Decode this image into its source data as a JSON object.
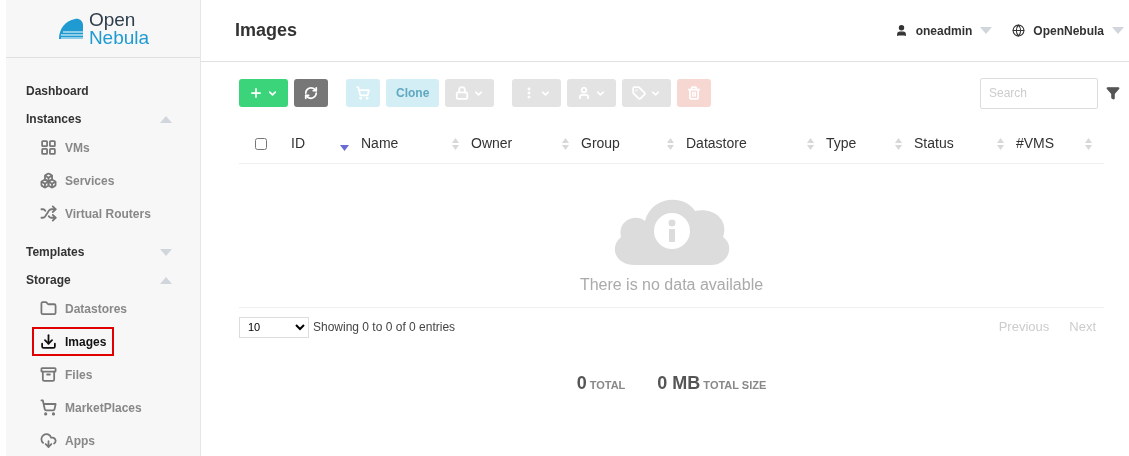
{
  "logo": {
    "line1": "Open",
    "line2": "Nebula"
  },
  "sidebar": [
    {
      "label": "Dashboard",
      "kind": "link"
    },
    {
      "label": "Instances",
      "kind": "section",
      "expanded": true,
      "children": [
        {
          "label": "VMs",
          "kind": "vms",
          "selected": false
        },
        {
          "label": "Services",
          "kind": "services",
          "selected": false
        },
        {
          "label": "Virtual Routers",
          "kind": "routers",
          "selected": false
        }
      ]
    },
    {
      "label": "Templates",
      "kind": "section",
      "expanded": false
    },
    {
      "label": "Storage",
      "kind": "section",
      "expanded": true,
      "children": [
        {
          "label": "Datastores",
          "kind": "datastores",
          "selected": false
        },
        {
          "label": "Images",
          "kind": "images",
          "selected": true
        },
        {
          "label": "Files",
          "kind": "files",
          "selected": false
        },
        {
          "label": "MarketPlaces",
          "kind": "marketplaces",
          "selected": false
        },
        {
          "label": "Apps",
          "kind": "apps",
          "selected": false
        }
      ]
    }
  ],
  "header": {
    "title": "Images",
    "user": "oneadmin",
    "zone": "OpenNebula"
  },
  "toolbar": [
    {
      "kind": "create",
      "disabled": false
    },
    {
      "kind": "refresh",
      "disabled": false
    },
    {
      "kind": "cart",
      "disabled": true
    },
    {
      "kind": "text",
      "label": "Clone",
      "disabled": true
    },
    {
      "kind": "lock",
      "disabled": true
    },
    {
      "kind": "more",
      "disabled": true
    },
    {
      "kind": "user",
      "disabled": true
    },
    {
      "kind": "tag",
      "disabled": true
    },
    {
      "kind": "delete",
      "disabled": true
    }
  ],
  "search": {
    "placeholder": "Search"
  },
  "table": {
    "select_all": {
      "checked": false
    },
    "columns": [
      {
        "label": "ID",
        "sorted": true
      },
      {
        "label": "Name",
        "sorted": false
      },
      {
        "label": "Owner",
        "sorted": false
      },
      {
        "label": "Group",
        "sorted": false
      },
      {
        "label": "Datastore",
        "sorted": false
      },
      {
        "label": "Type",
        "sorted": false
      },
      {
        "label": "Status",
        "sorted": false
      },
      {
        "label": "#VMS",
        "sorted": false
      }
    ],
    "empty_message": "There is no data available"
  },
  "footer": {
    "page_size": "10",
    "info": "Showing 0 to 0 of 0 entries",
    "previous": "Previous",
    "next": "Next"
  },
  "totals": [
    {
      "value": "0",
      "label": "TOTAL"
    },
    {
      "value": "0 MB",
      "label": "TOTAL SIZE"
    }
  ]
}
